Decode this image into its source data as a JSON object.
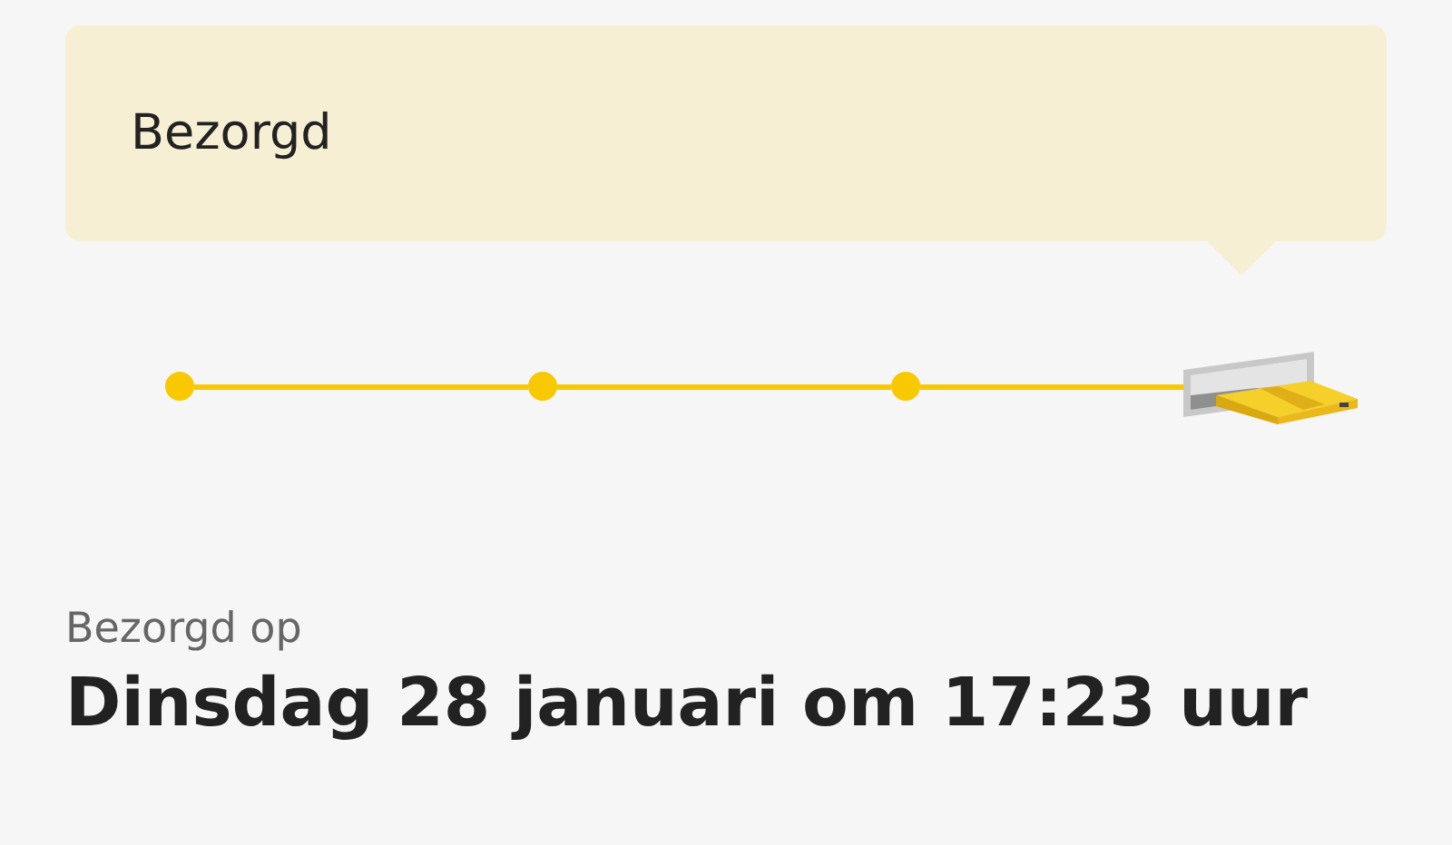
{
  "status_bubble": {
    "title": "Bezorgd"
  },
  "timeline": [
    {
      "kind": "dot"
    },
    {
      "kind": "dot"
    },
    {
      "kind": "dot"
    },
    {
      "kind": "mailbox"
    }
  ],
  "delivery": {
    "label": "Bezorgd op",
    "datetime": "Dinsdag 28 januari om 17:23 uur"
  }
}
